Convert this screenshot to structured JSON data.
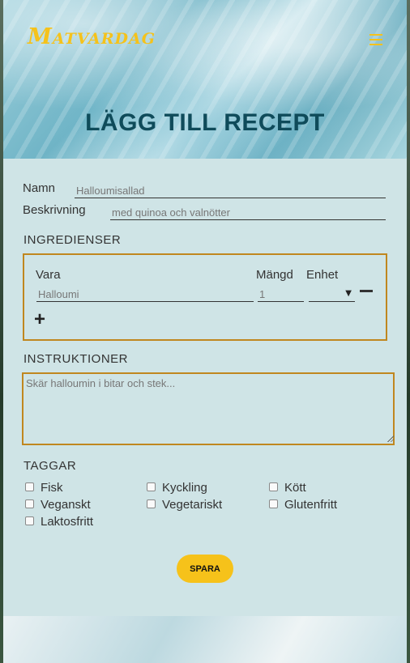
{
  "header": {
    "logo": "Matvardag",
    "menu_icon": "hamburger-menu-icon",
    "title": "LÄGG TILL RECEPT"
  },
  "form": {
    "name_label": "Namn",
    "name_placeholder": "Halloumisallad",
    "description_label": "Beskrivning",
    "description_placeholder": "med quinoa och valnötter",
    "ingredients": {
      "heading": "INGREDIENSER",
      "col_item": "Vara",
      "col_amount": "Mängd",
      "col_unit": "Enhet",
      "item_placeholder": "Halloumi",
      "amount_placeholder": "1",
      "unit_arrow": "▼",
      "remove_icon": "minus-icon",
      "add_icon": "plus-icon",
      "add_symbol": "+"
    },
    "instructions": {
      "heading": "INSTRUKTIONER",
      "placeholder": "Skär halloumin i bitar och stek..."
    },
    "tags": {
      "heading": "TAGGAR",
      "items": [
        "Fisk",
        "Kyckling",
        "Kött",
        "Veganskt",
        "Vegetariskt",
        "Glutenfritt",
        "Laktosfritt"
      ]
    },
    "save_label": "SPARA"
  },
  "colors": {
    "accent": "#f5c21b",
    "border": "#c0871f",
    "form_bg": "#cfe4e6",
    "title": "#0f4b5a"
  }
}
